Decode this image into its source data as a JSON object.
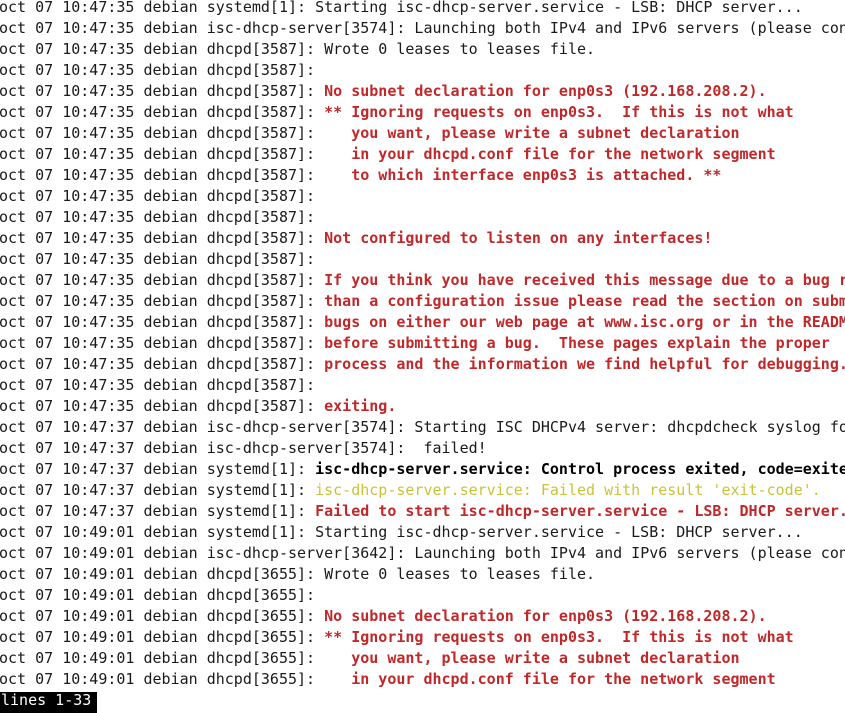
{
  "colors": {
    "background": "#ffffff",
    "text": "#1a1a1a",
    "error": "#c0282a",
    "warning": "#c9c33a",
    "status_bg": "#000000",
    "status_fg": "#ffffff"
  },
  "log_lines": [
    {
      "prefix": "oct 07 10:47:35 debian systemd[1]: ",
      "message": "Starting isc-dhcp-server.service - LSB: DHCP server...",
      "style": "normal"
    },
    {
      "prefix": "oct 07 10:47:35 debian isc-dhcp-server[3574]: ",
      "message": "Launching both IPv4 and IPv6 servers (please con",
      "style": "normal"
    },
    {
      "prefix": "oct 07 10:47:35 debian dhcpd[3587]: ",
      "message": "Wrote 0 leases to leases file.",
      "style": "normal"
    },
    {
      "prefix": "oct 07 10:47:35 debian dhcpd[3587]: ",
      "message": "",
      "style": "normal"
    },
    {
      "prefix": "oct 07 10:47:35 debian dhcpd[3587]: ",
      "message": "No subnet declaration for enp0s3 (192.168.208.2).",
      "style": "error"
    },
    {
      "prefix": "oct 07 10:47:35 debian dhcpd[3587]: ",
      "message": "** Ignoring requests on enp0s3.  If this is not what",
      "style": "error"
    },
    {
      "prefix": "oct 07 10:47:35 debian dhcpd[3587]: ",
      "message": "   you want, please write a subnet declaration",
      "style": "error"
    },
    {
      "prefix": "oct 07 10:47:35 debian dhcpd[3587]: ",
      "message": "   in your dhcpd.conf file for the network segment",
      "style": "error"
    },
    {
      "prefix": "oct 07 10:47:35 debian dhcpd[3587]: ",
      "message": "   to which interface enp0s3 is attached. **",
      "style": "error"
    },
    {
      "prefix": "oct 07 10:47:35 debian dhcpd[3587]: ",
      "message": "",
      "style": "normal"
    },
    {
      "prefix": "oct 07 10:47:35 debian dhcpd[3587]: ",
      "message": "",
      "style": "normal"
    },
    {
      "prefix": "oct 07 10:47:35 debian dhcpd[3587]: ",
      "message": "Not configured to listen on any interfaces!",
      "style": "error"
    },
    {
      "prefix": "oct 07 10:47:35 debian dhcpd[3587]: ",
      "message": "",
      "style": "normal"
    },
    {
      "prefix": "oct 07 10:47:35 debian dhcpd[3587]: ",
      "message": "If you think you have received this message due to a bug r",
      "style": "error"
    },
    {
      "prefix": "oct 07 10:47:35 debian dhcpd[3587]: ",
      "message": "than a configuration issue please read the section on subm",
      "style": "error"
    },
    {
      "prefix": "oct 07 10:47:35 debian dhcpd[3587]: ",
      "message": "bugs on either our web page at www.isc.org or in the READM",
      "style": "error"
    },
    {
      "prefix": "oct 07 10:47:35 debian dhcpd[3587]: ",
      "message": "before submitting a bug.  These pages explain the proper",
      "style": "error"
    },
    {
      "prefix": "oct 07 10:47:35 debian dhcpd[3587]: ",
      "message": "process and the information we find helpful for debugging.",
      "style": "error"
    },
    {
      "prefix": "oct 07 10:47:35 debian dhcpd[3587]: ",
      "message": "",
      "style": "normal"
    },
    {
      "prefix": "oct 07 10:47:35 debian dhcpd[3587]: ",
      "message": "exiting.",
      "style": "error"
    },
    {
      "prefix": "oct 07 10:47:37 debian isc-dhcp-server[3574]: ",
      "message": "Starting ISC DHCPv4 server: dhcpdcheck syslog fo",
      "style": "normal"
    },
    {
      "prefix": "oct 07 10:47:37 debian isc-dhcp-server[3574]: ",
      "message": " failed!",
      "style": "normal"
    },
    {
      "prefix": "oct 07 10:47:37 debian systemd[1]: ",
      "message": "isc-dhcp-server.service: Control process exited, code=exite",
      "style": "bold"
    },
    {
      "prefix": "oct 07 10:47:37 debian systemd[1]: ",
      "message": "isc-dhcp-server.service: Failed with result 'exit-code'.",
      "style": "warning"
    },
    {
      "prefix": "oct 07 10:47:37 debian systemd[1]: ",
      "message": "Failed to start isc-dhcp-server.service - LSB: DHCP server.",
      "style": "error"
    },
    {
      "prefix": "oct 07 10:49:01 debian systemd[1]: ",
      "message": "Starting isc-dhcp-server.service - LSB: DHCP server...",
      "style": "normal"
    },
    {
      "prefix": "oct 07 10:49:01 debian isc-dhcp-server[3642]: ",
      "message": "Launching both IPv4 and IPv6 servers (please con",
      "style": "normal"
    },
    {
      "prefix": "oct 07 10:49:01 debian dhcpd[3655]: ",
      "message": "Wrote 0 leases to leases file.",
      "style": "normal"
    },
    {
      "prefix": "oct 07 10:49:01 debian dhcpd[3655]: ",
      "message": "",
      "style": "normal"
    },
    {
      "prefix": "oct 07 10:49:01 debian dhcpd[3655]: ",
      "message": "No subnet declaration for enp0s3 (192.168.208.2).",
      "style": "error"
    },
    {
      "prefix": "oct 07 10:49:01 debian dhcpd[3655]: ",
      "message": "** Ignoring requests on enp0s3.  If this is not what",
      "style": "error"
    },
    {
      "prefix": "oct 07 10:49:01 debian dhcpd[3655]: ",
      "message": "   you want, please write a subnet declaration",
      "style": "error"
    },
    {
      "prefix": "oct 07 10:49:01 debian dhcpd[3655]: ",
      "message": "   in your dhcpd.conf file for the network segment",
      "style": "error"
    }
  ],
  "pager": {
    "status": "lines 1-33"
  }
}
